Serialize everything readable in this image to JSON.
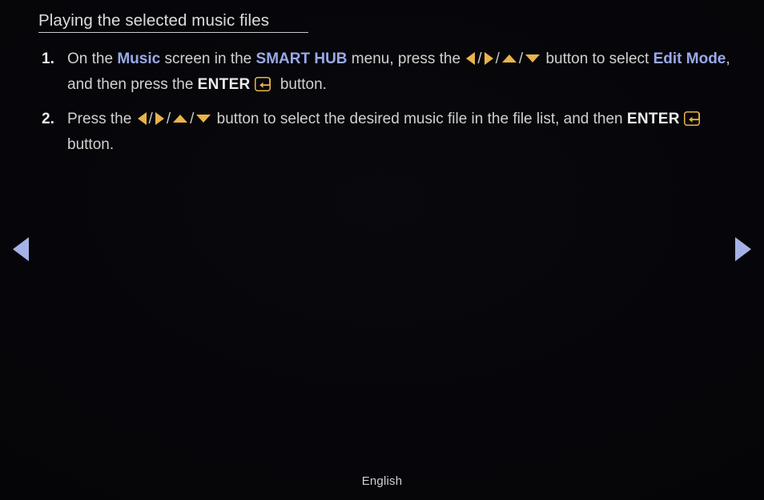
{
  "page": {
    "title": "Playing the selected music files",
    "language_label": "English",
    "background_color": "#06060a",
    "text_color": "#d0d0d0",
    "keyword_color": "#9aa9e8",
    "accent_gold_color": "#e7b44b",
    "nav_arrow_color": "#a6b2e6"
  },
  "nav": {
    "prev_icon": "triangle-left-icon",
    "next_icon": "triangle-right-icon"
  },
  "steps": [
    {
      "number": "1.",
      "parts": [
        {
          "type": "text",
          "value": "On the "
        },
        {
          "type": "kw",
          "value": "Music"
        },
        {
          "type": "text",
          "value": " screen in the "
        },
        {
          "type": "kw",
          "value": "SMART HUB"
        },
        {
          "type": "text",
          "value": " menu, press the "
        },
        {
          "type": "icon",
          "value": "arrow-left-icon"
        },
        {
          "type": "sep",
          "value": "/"
        },
        {
          "type": "icon",
          "value": "arrow-right-icon"
        },
        {
          "type": "sep",
          "value": "/"
        },
        {
          "type": "icon",
          "value": "arrow-up-icon"
        },
        {
          "type": "sep",
          "value": "/"
        },
        {
          "type": "icon",
          "value": "arrow-down-icon"
        },
        {
          "type": "text",
          "value": " button to select "
        },
        {
          "type": "kw",
          "value": "Edit Mode"
        },
        {
          "type": "text",
          "value": ", and then press the "
        },
        {
          "type": "bw",
          "value": "ENTER"
        },
        {
          "type": "icon",
          "value": "enter-key-icon"
        },
        {
          "type": "text",
          "value": " button."
        }
      ]
    },
    {
      "number": "2.",
      "parts": [
        {
          "type": "text",
          "value": "Press the "
        },
        {
          "type": "icon",
          "value": "arrow-left-icon"
        },
        {
          "type": "sep",
          "value": "/"
        },
        {
          "type": "icon",
          "value": "arrow-right-icon"
        },
        {
          "type": "sep",
          "value": "/"
        },
        {
          "type": "icon",
          "value": "arrow-up-icon"
        },
        {
          "type": "sep",
          "value": "/"
        },
        {
          "type": "icon",
          "value": "arrow-down-icon"
        },
        {
          "type": "text",
          "value": " button to select the desired music file in the file list, and then "
        },
        {
          "type": "bw",
          "value": "ENTER"
        },
        {
          "type": "icon",
          "value": "enter-key-icon"
        },
        {
          "type": "text",
          "value": " button."
        }
      ]
    }
  ]
}
